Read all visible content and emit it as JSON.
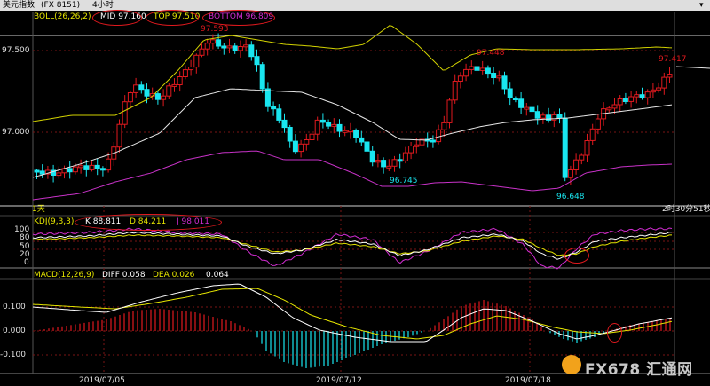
{
  "window": {
    "symbol_title": "美元指数",
    "symbol_code": "(FX 8151)",
    "period": "4小时"
  },
  "boll_panel": {
    "title": "BOLL(26,26,2)",
    "mid": "MID 97.160",
    "top": "TOP 97.510",
    "bottom": "BOTTOM 96.809",
    "y_ticks": [
      "97.500",
      "97.000"
    ],
    "annotations": {
      "high1": "97.593",
      "high2": "97.448",
      "high3": "97.417",
      "low1": "96.745",
      "low2": "96.648"
    },
    "corner_mark": "1天",
    "countdown": "2时30分51秒"
  },
  "kdj_panel": {
    "title": "KDJ(9,3,3)",
    "k": "K 88.811",
    "d": "D 84.211",
    "j": "J 98.011",
    "y_ticks": [
      "100",
      "80",
      "50",
      "20",
      "0"
    ]
  },
  "macd_panel": {
    "title": "MACD(12,26,9)",
    "diff": "DIFF 0.058",
    "dea": "DEA 0.026",
    "macd": "0.064",
    "y_ticks": [
      "0.100",
      "0.000",
      "-0.100"
    ]
  },
  "x_axis": {
    "labels": [
      "2019/07/05",
      "2019/07/12",
      "2019/07/18"
    ]
  },
  "watermark": {
    "text": "FX678 汇通网"
  },
  "colors": {
    "up": "#e0191e",
    "down": "#19e6f0",
    "k_line": "#ffffff",
    "d_line": "#e6e600",
    "j_line": "#d22cd2",
    "mid_line": "#e6e6e6",
    "top_line": "#d2d200",
    "bottom_line": "#c832c8",
    "highlight_ring": "#e0191e"
  }
}
